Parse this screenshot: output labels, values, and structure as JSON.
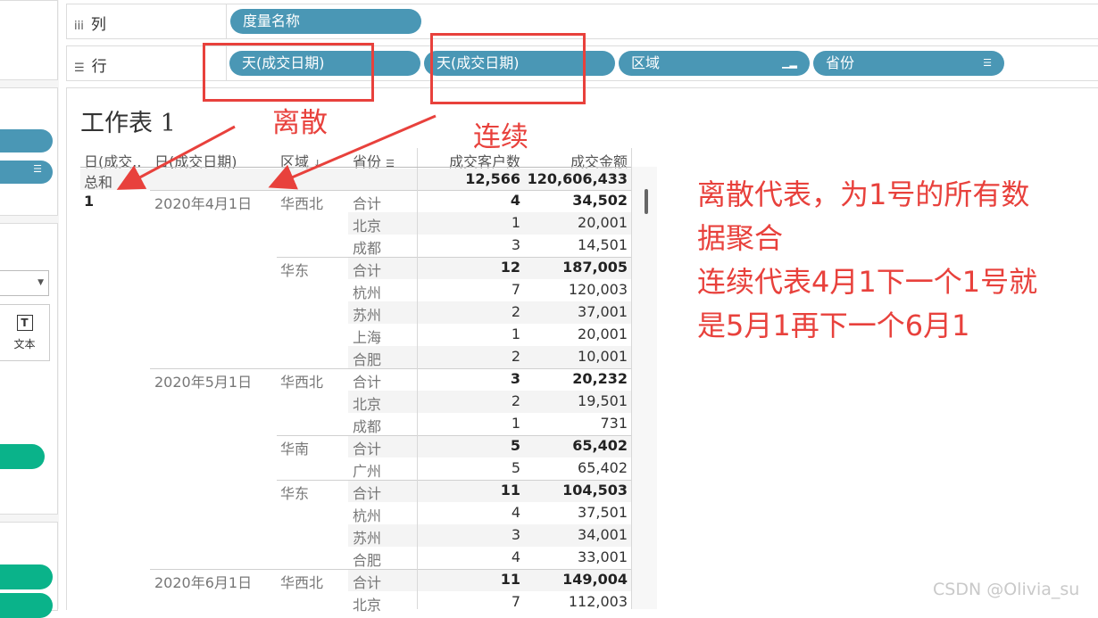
{
  "shelves": {
    "columns": {
      "icon": "columns-icon",
      "label": "列",
      "pills": [
        "度量名称"
      ]
    },
    "rows": {
      "icon": "rows-icon",
      "label": "行",
      "pills": [
        {
          "label": "天(成交日期)",
          "sort": false
        },
        {
          "label": "天(成交日期)",
          "sort": false
        },
        {
          "label": "区域",
          "sort": true
        },
        {
          "label": "省份",
          "sort": true
        }
      ]
    }
  },
  "marks": {
    "text_label": "文本",
    "text_icon": "text-mark-icon"
  },
  "sheet": {
    "title": "工作表 1",
    "headers": {
      "day_discrete": "日(成交..",
      "day_continuous": "日(成交日期)",
      "region": "区域",
      "province": "省份",
      "customers": "成交客户数",
      "amount": "成交金额"
    },
    "total": {
      "label": "总和",
      "customers": "12,566",
      "amount": "120,606,433"
    },
    "day_value": "1",
    "rows": [
      {
        "date": "2020年4月1日",
        "region": "华西北",
        "province": "合计",
        "customers": "4",
        "amount": "34,502",
        "subtotal": true
      },
      {
        "province": "北京",
        "customers": "1",
        "amount": "20,001"
      },
      {
        "province": "成都",
        "customers": "3",
        "amount": "14,501"
      },
      {
        "region": "华东",
        "province": "合计",
        "customers": "12",
        "amount": "187,005",
        "subtotal": true
      },
      {
        "province": "杭州",
        "customers": "7",
        "amount": "120,003"
      },
      {
        "province": "苏州",
        "customers": "2",
        "amount": "37,001"
      },
      {
        "province": "上海",
        "customers": "1",
        "amount": "20,001"
      },
      {
        "province": "合肥",
        "customers": "2",
        "amount": "10,001"
      },
      {
        "date": "2020年5月1日",
        "region": "华西北",
        "province": "合计",
        "customers": "3",
        "amount": "20,232",
        "subtotal": true
      },
      {
        "province": "北京",
        "customers": "2",
        "amount": "19,501"
      },
      {
        "province": "成都",
        "customers": "1",
        "amount": "731"
      },
      {
        "region": "华南",
        "province": "合计",
        "customers": "5",
        "amount": "65,402",
        "subtotal": true
      },
      {
        "province": "广州",
        "customers": "5",
        "amount": "65,402"
      },
      {
        "region": "华东",
        "province": "合计",
        "customers": "11",
        "amount": "104,503",
        "subtotal": true
      },
      {
        "province": "杭州",
        "customers": "4",
        "amount": "37,501"
      },
      {
        "province": "苏州",
        "customers": "3",
        "amount": "34,001"
      },
      {
        "province": "合肥",
        "customers": "4",
        "amount": "33,001"
      },
      {
        "date": "2020年6月1日",
        "region": "华西北",
        "province": "合计",
        "customers": "11",
        "amount": "149,004",
        "subtotal": true
      },
      {
        "province": "北京",
        "customers": "7",
        "amount": "112,003"
      }
    ]
  },
  "annotations": {
    "discrete": "离散",
    "continuous": "连续",
    "note_lines": [
      "离散代表，为1号的所有数",
      "据聚合",
      "连续代表4月1下一个1号就",
      "是5月1再下一个6月1"
    ],
    "color": "#e8413c"
  },
  "watermark": "CSDN @Olivia_su",
  "colors": {
    "pill_blue": "#4a97b5",
    "pill_green": "#0ab38a"
  }
}
